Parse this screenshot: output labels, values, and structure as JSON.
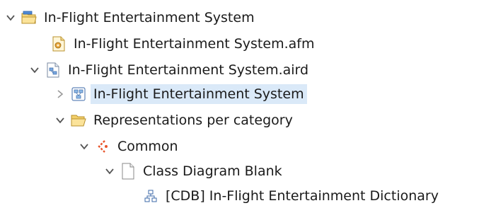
{
  "tree": {
    "project": {
      "label": "In-Flight Entertainment System",
      "expanded": true,
      "icon": "project-folder-icon"
    },
    "afm_file": {
      "label": "In-Flight Entertainment System.afm",
      "icon": "afm-file-icon"
    },
    "aird_file": {
      "label": "In-Flight Entertainment System.aird",
      "expanded": true,
      "icon": "aird-file-icon"
    },
    "model_root": {
      "label": "In-Flight Entertainment System",
      "expanded": false,
      "selected": true,
      "icon": "model-icon"
    },
    "representations": {
      "label": "Representations per category",
      "expanded": true,
      "icon": "open-folder-icon"
    },
    "common": {
      "label": "Common",
      "expanded": true,
      "icon": "viewpoint-icon"
    },
    "class_diagram": {
      "label": "Class Diagram Blank",
      "expanded": true,
      "icon": "blank-page-icon"
    },
    "cdb_dictionary": {
      "label": "[CDB] In-Flight Entertainment Dictionary",
      "icon": "class-diagram-icon"
    }
  },
  "colors": {
    "selection": "#dae9f8",
    "twisty": "#555555",
    "folder": "#e8b84a",
    "viewpoint": "#e8542a",
    "diagram": "#3d78c4"
  }
}
